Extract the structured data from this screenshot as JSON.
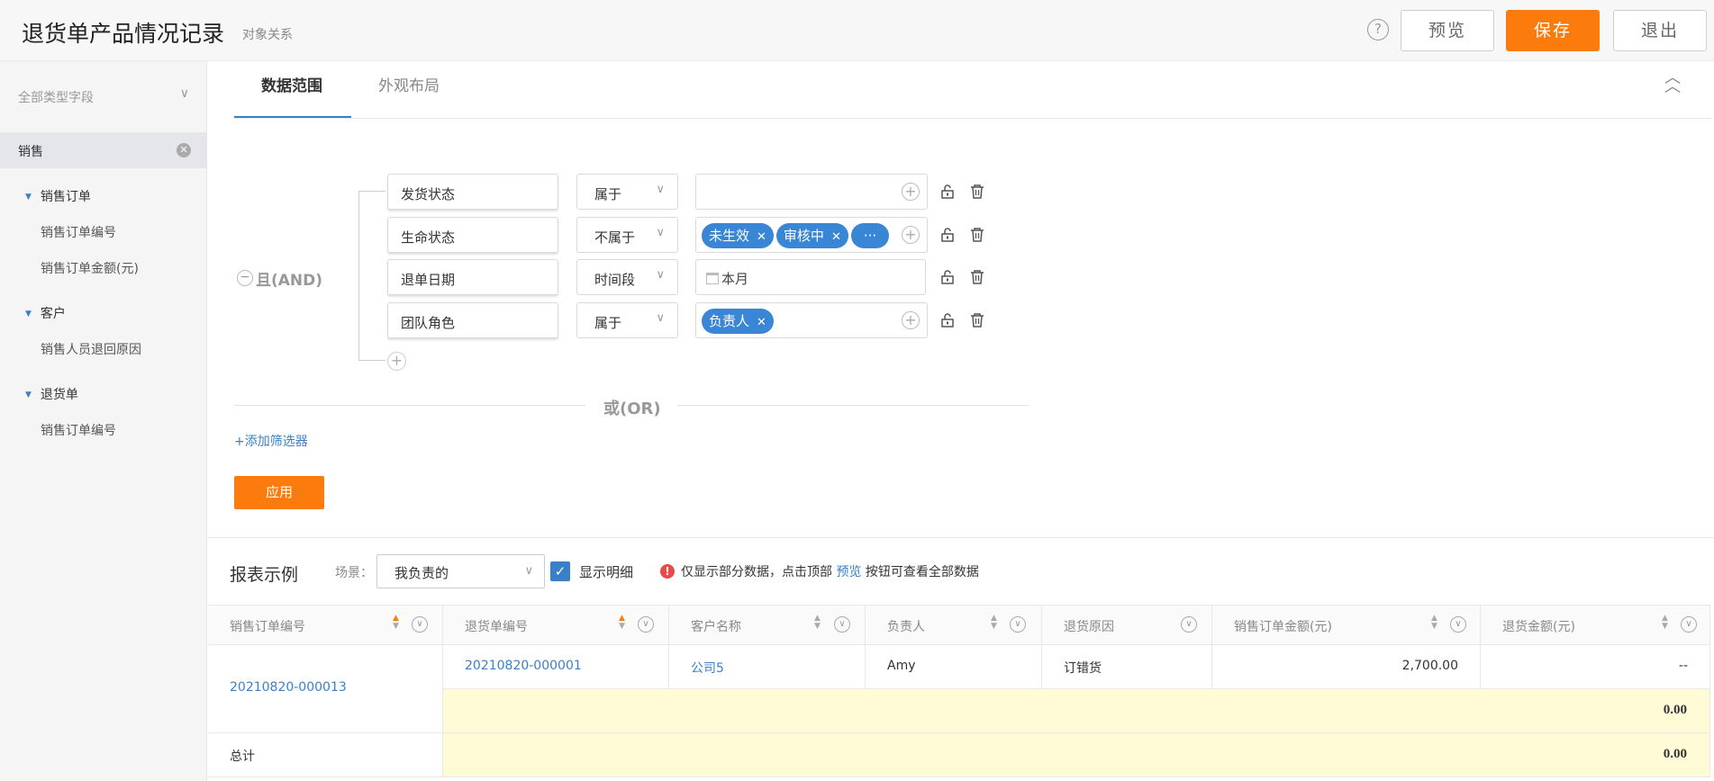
{
  "header": {
    "title": "退货单产品情况记录",
    "subtitle": "对象关系",
    "help": "?",
    "preview_label": "预览",
    "save_label": "保存",
    "exit_label": "退出"
  },
  "sidebar": {
    "field_type_select": "全部类型字段",
    "search_value": "销售",
    "groups": [
      {
        "label": "销售订单",
        "items": [
          "销售订单编号",
          "销售订单金额(元)"
        ]
      },
      {
        "label": "客户",
        "items": [
          "销售人员退回原因"
        ]
      },
      {
        "label": "退货单",
        "items": [
          "销售订单编号"
        ]
      }
    ]
  },
  "tabs": [
    {
      "label": "数据范围",
      "active": true
    },
    {
      "label": "外观布局",
      "active": false
    }
  ],
  "filter": {
    "logic_label": "且(AND)",
    "conditions": [
      {
        "field": "发货状态",
        "operator": "属于",
        "tags": [],
        "text": ""
      },
      {
        "field": "生命状态",
        "operator": "不属于",
        "tags": [
          "未生效",
          "审核中"
        ],
        "more": "···",
        "text": ""
      },
      {
        "field": "退单日期",
        "operator": "时间段",
        "tags": [],
        "text": "本月"
      },
      {
        "field": "团队角色",
        "operator": "属于",
        "tags": [
          "负责人"
        ],
        "text": ""
      }
    ],
    "or_label": "或(OR)",
    "add_filter_label": "+添加筛选器",
    "apply_label": "应用"
  },
  "report": {
    "title": "报表示例",
    "scene_label": "场景：",
    "scene_value": "我负责的",
    "show_detail_label": "显示明细",
    "show_detail_checked": true,
    "notice_prefix": "仅显示部分数据，点击顶部",
    "notice_link": "预览",
    "notice_suffix": "按钮可查看全部数据"
  },
  "table": {
    "columns": [
      "销售订单编号",
      "退货单编号",
      "客户名称",
      "负责人",
      "退货原因",
      "销售订单金额(元)",
      "退货金额(元)"
    ],
    "group_key": "20210820-000013",
    "row": {
      "return_no": "20210820-000001",
      "customer": "公司5",
      "owner": "Amy",
      "reason": "订错货",
      "order_amount": "2,700.00",
      "return_amount": "--"
    },
    "subtotal": "0.00",
    "total_label": "总计",
    "total": "0.00"
  },
  "colors": {
    "accent": "#fb7c0c",
    "primary": "#3a80c8",
    "subtotal_bg": "#fffbd6"
  }
}
